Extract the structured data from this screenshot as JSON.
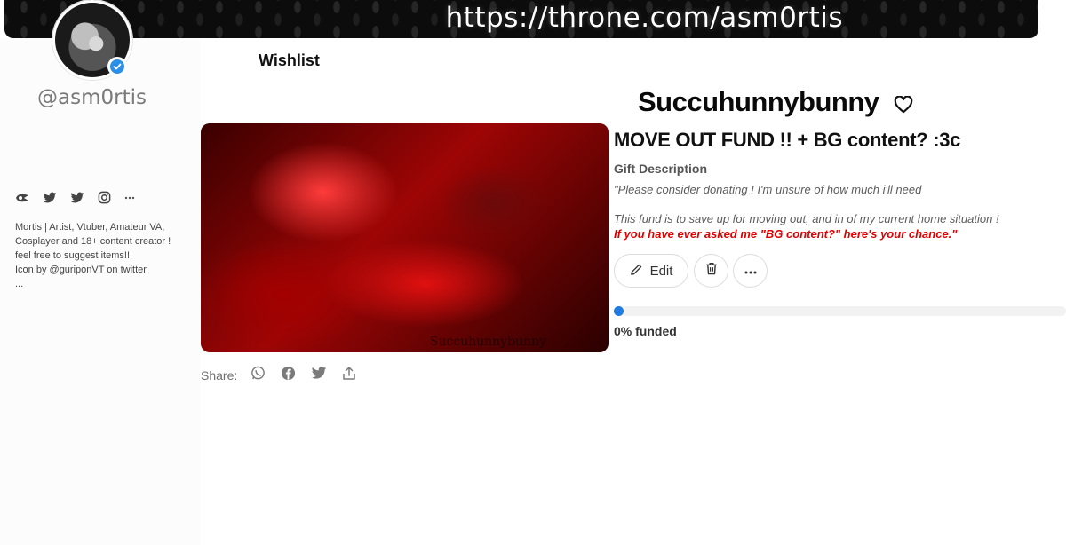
{
  "banner": {
    "url_text": "https://throne.com/asm0rtis"
  },
  "profile": {
    "username": "@asm0rtis",
    "verified": true,
    "social_icons": [
      "throne-icon",
      "twitter-icon",
      "twitter-icon",
      "instagram-icon",
      "more-icon"
    ],
    "bio_lines": [
      "Mortis | Artist, Vtuber, Amateur VA,",
      "Cosplayer and 18+ content creator !",
      "feel free to suggest items!!",
      "Icon by @guriponVT on twitter",
      "..."
    ]
  },
  "wishlist": {
    "title": "Wishlist"
  },
  "item": {
    "store_name": "Succuhunnybunny",
    "heart_icon": "heart-outline-icon",
    "image_watermark": "Succuhunnybunny",
    "title": "MOVE OUT FUND !! + BG content? :3c",
    "gift_description_label": "Gift Description",
    "description_line1": "\"Please consider donating ! I'm unsure of how much i'll need",
    "description_line2": "This fund is to save up for moving out, and in of my current home situation !",
    "description_line3": "If you have ever asked me \"BG content?\" here's your chance.\"",
    "edit_label": "Edit",
    "funded_text": "0% funded",
    "funded_fraction": 0.0
  },
  "share": {
    "label": "Share:",
    "icons": [
      "whatsapp-icon",
      "facebook-icon",
      "twitter-icon",
      "upload-icon"
    ]
  },
  "colors": {
    "accent": "#1e7be0",
    "verified": "#2b8fe8",
    "desc_red": "#e00000",
    "banner_bg": "#0c0c0c"
  }
}
